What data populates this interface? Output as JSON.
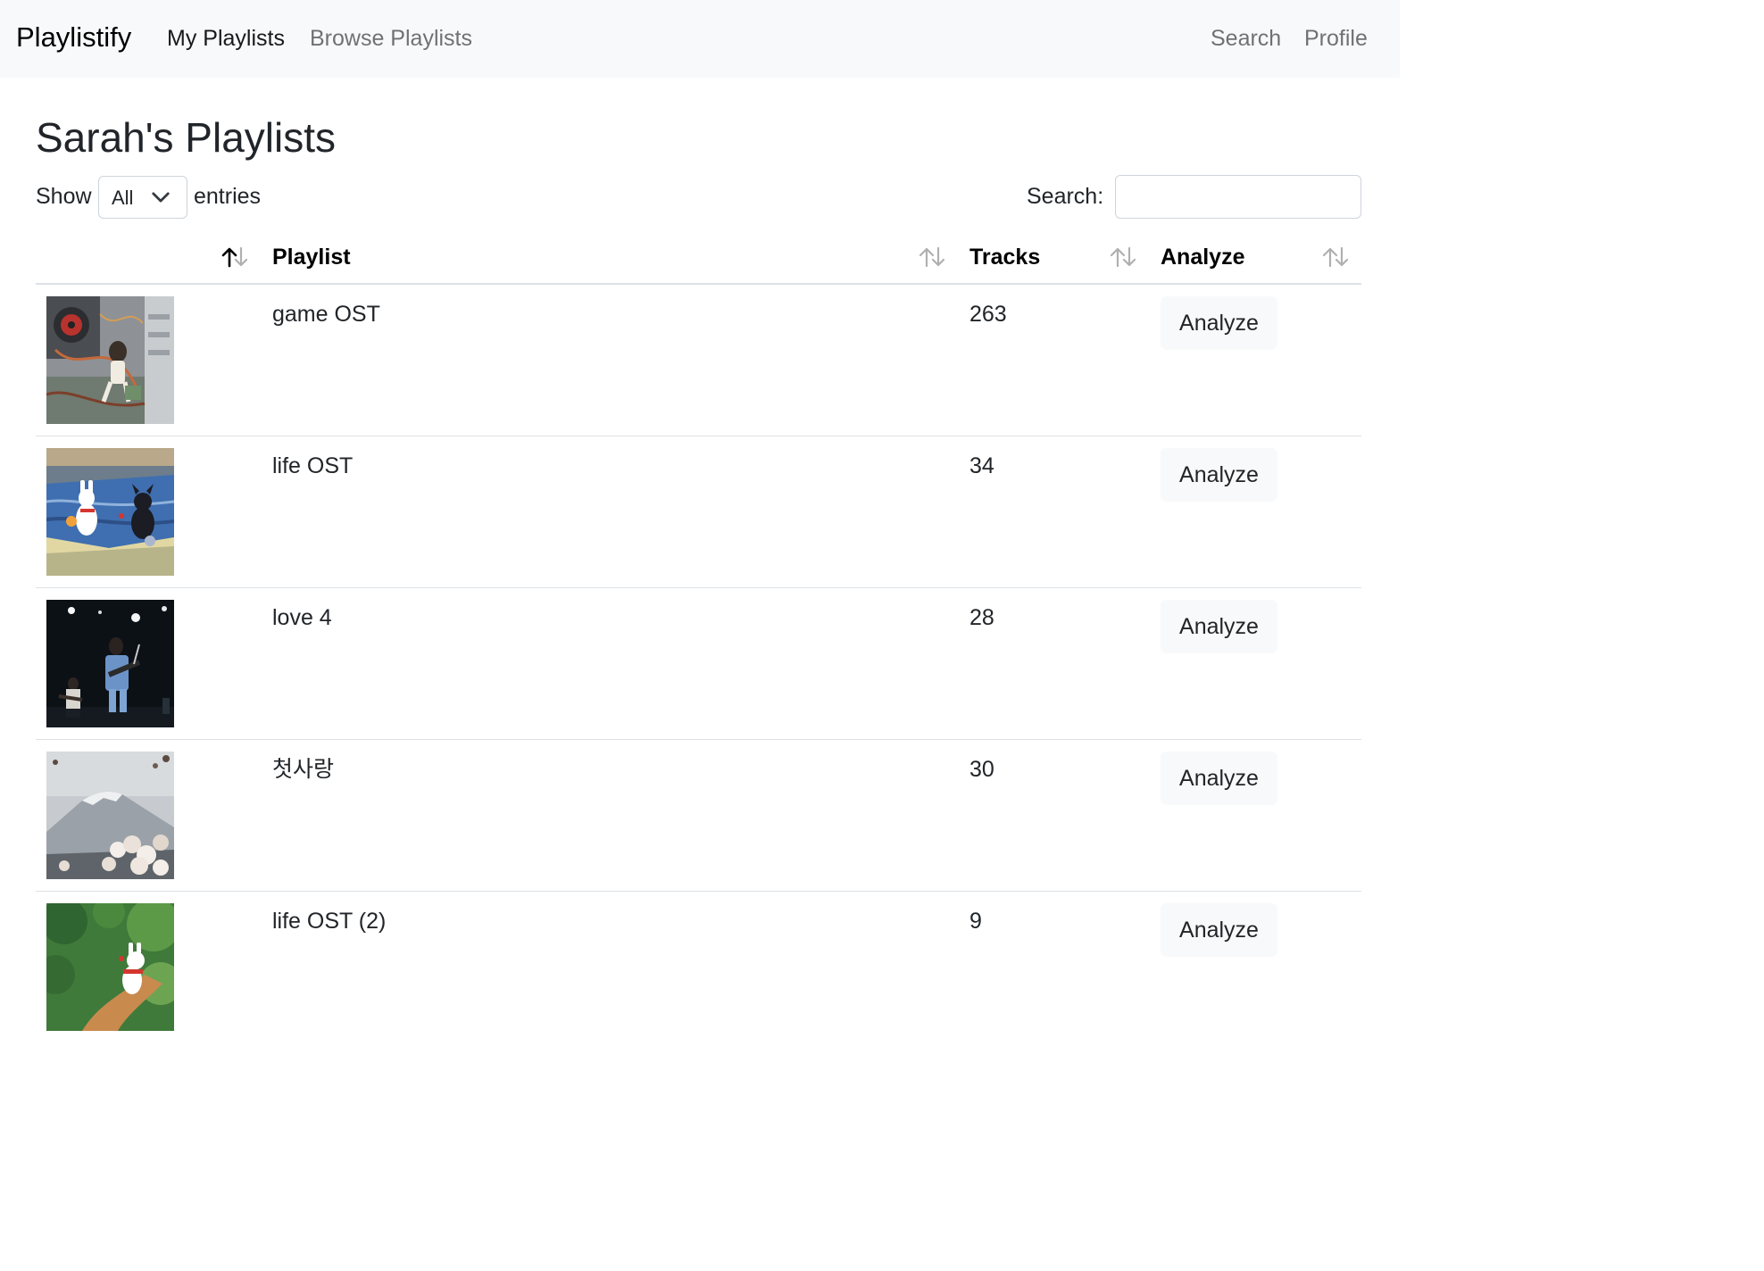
{
  "navbar": {
    "brand": "Playlistify",
    "links": [
      {
        "label": "My Playlists",
        "active": true
      },
      {
        "label": "Browse Playlists",
        "active": false
      }
    ],
    "right_links": [
      {
        "label": "Search"
      },
      {
        "label": "Profile"
      }
    ]
  },
  "page_title": "Sarah's Playlists",
  "length_control": {
    "show_label": "Show",
    "selected": "All",
    "entries_label": "entries"
  },
  "search": {
    "label": "Search:",
    "value": "",
    "placeholder": ""
  },
  "table": {
    "columns": [
      {
        "label": "",
        "sort": "ascending"
      },
      {
        "label": "Playlist",
        "sort": "none"
      },
      {
        "label": "Tracks",
        "sort": "none"
      },
      {
        "label": "Analyze",
        "sort": "none"
      }
    ],
    "rows": [
      {
        "name": "game OST",
        "tracks": "263",
        "button": "Analyze",
        "thumb_icon": "anime-girl-in-pc-case-artwork"
      },
      {
        "name": "life OST",
        "tracks": "34",
        "button": "Analyze",
        "thumb_icon": "white-dog-black-cat-riverside-painting"
      },
      {
        "name": "love 4",
        "tracks": "28",
        "button": "Analyze",
        "thumb_icon": "live-band-concert-photo"
      },
      {
        "name": "첫사랑",
        "tracks": "30",
        "button": "Analyze",
        "thumb_icon": "mountain-cherry-blossom-photo"
      },
      {
        "name": "life OST (2)",
        "tracks": "9",
        "button": "Analyze",
        "thumb_icon": "white-dog-forest-painting"
      }
    ]
  },
  "colors": {
    "navbar_bg": "#f8f9fa",
    "text": "#212529",
    "muted_nav": "#737373",
    "border": "#dee2e6",
    "button_bg": "#f8f9fa"
  }
}
